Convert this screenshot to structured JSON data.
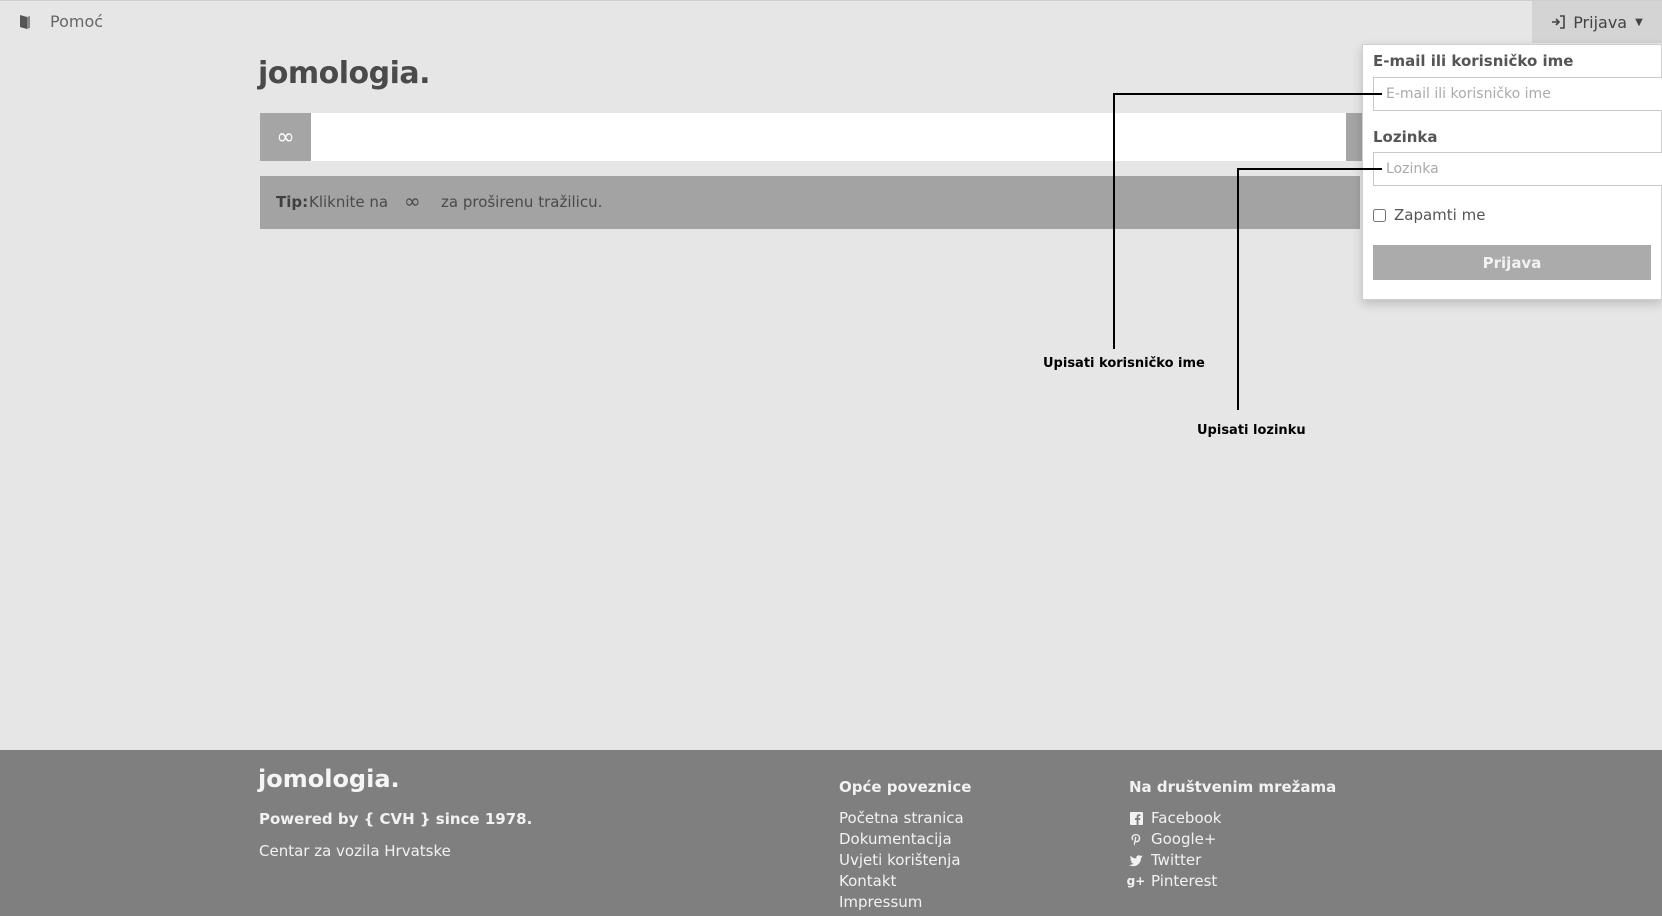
{
  "topbar": {
    "help_label": "Pomoć",
    "login_label": "Prijava"
  },
  "brand": {
    "logo": "jomologia."
  },
  "search": {
    "advanced_icon": "∞",
    "value": ""
  },
  "tip": {
    "label": "Tip:",
    "text_before": "Kliknite na",
    "icon": "∞",
    "text_after": "za proširenu tražilicu."
  },
  "login_form": {
    "email_label": "E-mail ili korisničko ime",
    "email_placeholder": "E-mail ili korisničko ime",
    "password_label": "Lozinka",
    "password_placeholder": "Lozinka",
    "remember_label": "Zapamti me",
    "submit_label": "Prijava"
  },
  "annotations": {
    "username_hint": "Upisati korisničko ime",
    "password_hint": "Upisati lozinku"
  },
  "footer": {
    "logo": "jomologia.",
    "powered": "Powered by { CVH } since 1978.",
    "organization": "Centar za vozila Hrvatske",
    "general_links": {
      "heading": "Opće poveznice",
      "items": [
        "Početna stranica",
        "Dokumentacija",
        "Uvjeti korištenja",
        "Kontakt",
        "Impressum"
      ]
    },
    "social": {
      "heading": "Na društvenim mrežama",
      "items": [
        {
          "label": "Facebook",
          "icon": "facebook-icon"
        },
        {
          "label": "Google+",
          "icon": "pinterest-icon"
        },
        {
          "label": "Twitter",
          "icon": "twitter-icon"
        },
        {
          "label": "Pinterest",
          "icon": "google-plus-icon"
        }
      ]
    }
  },
  "colors": {
    "background": "#e6e6e6",
    "footer": "#7f7f7f",
    "accent_gray": "#a5a5a5"
  }
}
